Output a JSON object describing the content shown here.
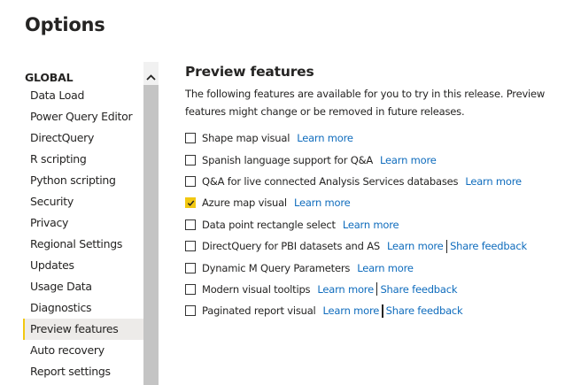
{
  "page": {
    "title": "Options"
  },
  "sidebar": {
    "section": "GLOBAL",
    "items": [
      {
        "label": "Data Load"
      },
      {
        "label": "Power Query Editor"
      },
      {
        "label": "DirectQuery"
      },
      {
        "label": "R scripting"
      },
      {
        "label": "Python scripting"
      },
      {
        "label": "Security"
      },
      {
        "label": "Privacy"
      },
      {
        "label": "Regional Settings"
      },
      {
        "label": "Updates"
      },
      {
        "label": "Usage Data"
      },
      {
        "label": "Diagnostics"
      },
      {
        "label": "Preview features",
        "active": true
      },
      {
        "label": "Auto recovery"
      },
      {
        "label": "Report settings"
      }
    ]
  },
  "content": {
    "heading": "Preview features",
    "description": "The following features are available for you to try in this release. Preview features might change or be removed in future releases.",
    "features": [
      {
        "label": "Shape map visual",
        "checked": false,
        "learn_more": "Learn more"
      },
      {
        "label": "Spanish language support for Q&A",
        "checked": false,
        "learn_more": "Learn more"
      },
      {
        "label": "Q&A for live connected Analysis Services databases",
        "checked": false,
        "learn_more": "Learn more"
      },
      {
        "label": "Azure map visual",
        "checked": true,
        "learn_more": "Learn more"
      },
      {
        "label": "Data point rectangle select",
        "checked": false,
        "learn_more": "Learn more"
      },
      {
        "label": "DirectQuery for PBI datasets and AS",
        "checked": false,
        "learn_more": "Learn more",
        "feedback": "Share feedback"
      },
      {
        "label": "Dynamic M Query Parameters",
        "checked": false,
        "learn_more": "Learn more"
      },
      {
        "label": "Modern visual tooltips",
        "checked": false,
        "learn_more": "Learn more",
        "feedback": "Share feedback"
      },
      {
        "label": "Paginated report visual",
        "checked": false,
        "learn_more": "Learn more",
        "feedback": "Share feedback"
      }
    ]
  },
  "colors": {
    "accent": "#f2c811",
    "link": "#0f6cbd",
    "active_bg": "#edebe9"
  },
  "icons": {
    "scroll_up": "chevron-up-icon",
    "check": "checkmark-icon"
  }
}
